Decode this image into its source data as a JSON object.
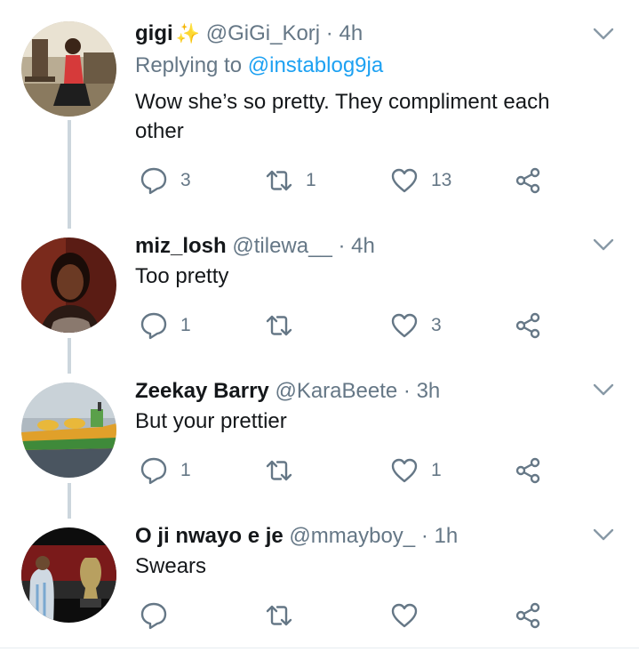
{
  "tweets": [
    {
      "name": "gigi",
      "has_sparkle": true,
      "handle": "@GiGi_Korj",
      "time": "4h",
      "replying_label": "Replying to ",
      "replying_to": "@instablog9ja",
      "text": "Wow she’s so pretty. They compliment each other",
      "replies": "3",
      "retweets": "1",
      "likes": "13"
    },
    {
      "name": "miz_losh",
      "handle": "@tilewa__",
      "time": "4h",
      "text": "Too pretty",
      "replies": "1",
      "retweets": "",
      "likes": "3"
    },
    {
      "name": "Zeekay Barry",
      "handle": "@KaraBeete",
      "time": "3h",
      "text": "But your prettier",
      "replies": "1",
      "retweets": "",
      "likes": "1"
    },
    {
      "name": "O ji nwayo e je",
      "handle": "@mmayboy_",
      "time": "1h",
      "text": "Swears",
      "replies": "",
      "retweets": "",
      "likes": ""
    }
  ],
  "separator": "·",
  "icons": {
    "caret": "chevron-down-icon",
    "reply": "reply-icon",
    "retweet": "retweet-icon",
    "like": "heart-icon",
    "share": "share-icon",
    "sparkle": "sparkles-icon"
  },
  "colors": {
    "link": "#1da1f2",
    "secondary": "#657786",
    "thread_line": "#ccd6dd",
    "sparkle": "#ffcc4d"
  }
}
